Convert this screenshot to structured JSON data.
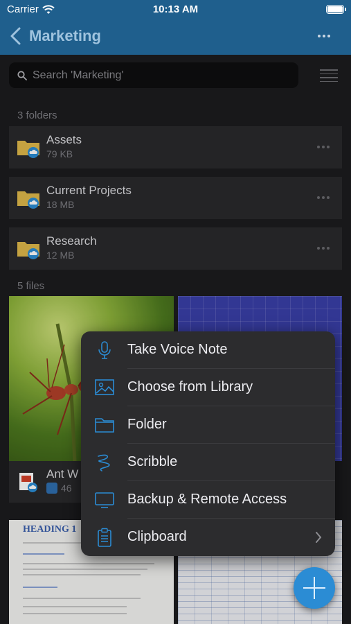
{
  "status_bar": {
    "carrier": "Carrier",
    "time": "10:13 AM",
    "wifi_icon": "wifi-icon",
    "battery_icon": "battery-icon"
  },
  "nav": {
    "title": "Marketing",
    "back_icon": "chevron-left-icon",
    "more_icon": "ellipsis-icon"
  },
  "search": {
    "placeholder": "Search 'Marketing'",
    "icon": "search-icon"
  },
  "folders_section": {
    "header": "3 folders",
    "items": [
      {
        "name": "Assets",
        "size": "79 KB"
      },
      {
        "name": "Current Projects",
        "size": "18 MB"
      },
      {
        "name": "Research",
        "size": "12 MB"
      }
    ]
  },
  "files_section": {
    "header": "5 files",
    "visible_file": {
      "name": "Ant W",
      "size": "46"
    },
    "doc_preview_heading": "HEADING 1"
  },
  "menu": {
    "items": [
      {
        "label": "Take Voice Note",
        "icon": "microphone-icon"
      },
      {
        "label": "Choose from Library",
        "icon": "image-icon"
      },
      {
        "label": "Folder",
        "icon": "folder-icon"
      },
      {
        "label": "Scribble",
        "icon": "scribble-icon"
      },
      {
        "label": "Backup & Remote Access",
        "icon": "monitor-icon"
      },
      {
        "label": "Clipboard",
        "icon": "clipboard-icon",
        "has_submenu": true
      }
    ]
  },
  "fab": {
    "icon": "plus-icon"
  },
  "colors": {
    "nav_bar": "#1f5f8d",
    "accent": "#2b8cd4",
    "background": "#1c1c1e",
    "row": "#2a2a2c",
    "menu": "#2c2c2e"
  }
}
